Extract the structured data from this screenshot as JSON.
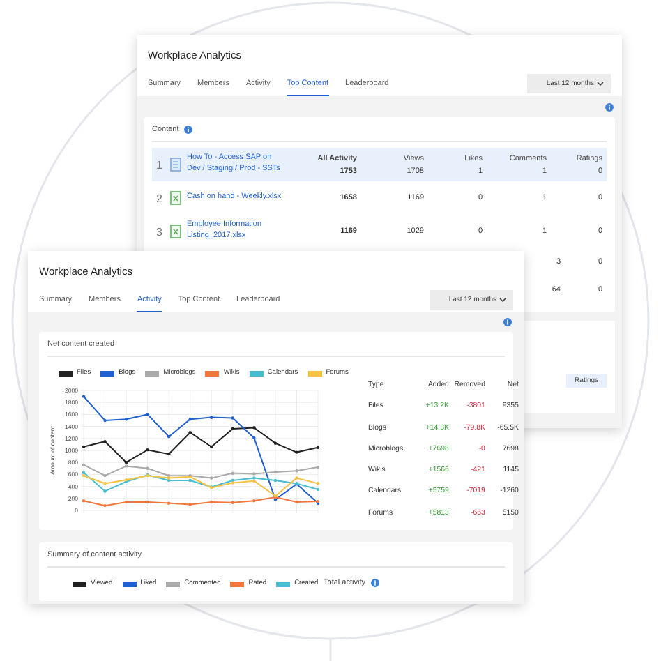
{
  "background_window": {
    "title": "Workplace Analytics",
    "tabs": [
      {
        "label": "Summary",
        "selected": false
      },
      {
        "label": "Members",
        "selected": false
      },
      {
        "label": "Activity",
        "selected": false
      },
      {
        "label": "Top Content",
        "selected": true
      },
      {
        "label": "Leaderboard",
        "selected": false
      }
    ],
    "period": "Last 12 months",
    "content_card": {
      "title": "Content",
      "columns": [
        "All Activity",
        "Views",
        "Likes",
        "Comments",
        "Ratings"
      ],
      "rows": [
        {
          "rank": "1",
          "kind": "document",
          "title": "How To - Access SAP on Dev / Staging / Prod - SSTs",
          "selected": true,
          "cells": [
            "1753",
            "1708",
            "1",
            "1",
            "0"
          ]
        },
        {
          "rank": "2",
          "kind": "spreadsheet",
          "title": "Cash on hand - Weekly.xlsx",
          "selected": false,
          "cells": [
            "1658",
            "1169",
            "0",
            "1",
            "0"
          ]
        },
        {
          "rank": "3",
          "kind": "spreadsheet",
          "title": "Employee Information Listing_2017.xlsx",
          "selected": false,
          "cells": [
            "1169",
            "1029",
            "0",
            "1",
            "0"
          ]
        },
        {
          "selected": false,
          "cells": [
            null,
            null,
            null,
            "3",
            "0"
          ]
        },
        {
          "selected": false,
          "cells": [
            null,
            null,
            null,
            "64",
            "0"
          ]
        }
      ]
    },
    "second_card": {
      "columns": [
        "Ratings"
      ]
    }
  },
  "front_window": {
    "title": "Workplace Analytics",
    "tabs": [
      {
        "label": "Summary",
        "selected": false
      },
      {
        "label": "Members",
        "selected": false
      },
      {
        "label": "Activity",
        "selected": true
      },
      {
        "label": "Top Content",
        "selected": false
      },
      {
        "label": "Leaderboard",
        "selected": false
      }
    ],
    "period": "Last 12 months",
    "net_content": {
      "title": "Net content created",
      "chart_data": {
        "type": "line",
        "grid": true,
        "legend": "top",
        "ylabel": "Amount of content",
        "ylim": [
          0,
          2000
        ],
        "yticks": [
          0,
          200,
          400,
          600,
          800,
          1000,
          1200,
          1400,
          1600,
          1800,
          2000
        ],
        "series": [
          {
            "name": "Files",
            "color": "#222222",
            "values": [
              1060,
              1150,
              800,
              1010,
              940,
              1300,
              1060,
              1360,
              1380,
              1120,
              970,
              1050
            ]
          },
          {
            "name": "Blogs",
            "color": "#1f5fd0",
            "values": [
              1900,
              1500,
              1520,
              1600,
              1230,
              1520,
              1550,
              1540,
              1210,
              180,
              440,
              120
            ]
          },
          {
            "name": "Microblogs",
            "color": "#aaaaaa",
            "values": [
              760,
              580,
              740,
              700,
              580,
              580,
              540,
              620,
              610,
              640,
              660,
              720
            ]
          },
          {
            "name": "Wikis",
            "color": "#f2763c",
            "values": [
              160,
              80,
              140,
              140,
              120,
              100,
              140,
              130,
              160,
              220,
              140,
              150
            ]
          },
          {
            "name": "Calendars",
            "color": "#48bcd0",
            "values": [
              630,
              320,
              480,
              590,
              500,
              500,
              390,
              500,
              540,
              500,
              450,
              350
            ]
          },
          {
            "name": "Forums",
            "color": "#f5c242",
            "values": [
              580,
              450,
              510,
              580,
              540,
              560,
              380,
              460,
              490,
              240,
              540,
              450
            ]
          }
        ]
      },
      "table": {
        "columns": [
          "Type",
          "Added",
          "Removed",
          "Net"
        ],
        "rows": [
          {
            "type": "Files",
            "added": "+13.2K",
            "removed": "-3801",
            "net": "9355"
          },
          {
            "type": "Blogs",
            "added": "+14.3K",
            "removed": "-79.8K",
            "net": "-65.5K"
          },
          {
            "type": "Microblogs",
            "added": "+7698",
            "removed": "-0",
            "net": "7698"
          },
          {
            "type": "Wikis",
            "added": "+1566",
            "removed": "-421",
            "net": "1145"
          },
          {
            "type": "Calendars",
            "added": "+5759",
            "removed": "-7019",
            "net": "-1260"
          },
          {
            "type": "Forums",
            "added": "+5813",
            "removed": "-663",
            "net": "5150"
          }
        ]
      }
    },
    "activity_summary": {
      "title": "Summary of content activity",
      "legend": [
        {
          "label": "Viewed",
          "color": "#222222"
        },
        {
          "label": "Liked",
          "color": "#1f5fd0"
        },
        {
          "label": "Commented",
          "color": "#aaaaaa"
        },
        {
          "label": "Rated",
          "color": "#f2763c"
        },
        {
          "label": "Created",
          "color": "#48bcd0"
        }
      ],
      "total_label": "Total activity"
    }
  }
}
